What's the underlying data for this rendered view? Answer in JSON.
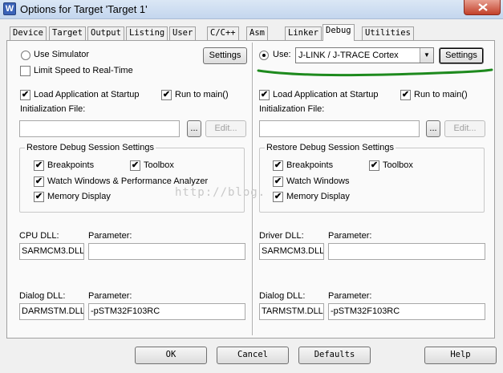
{
  "window": {
    "title": "Options for Target 'Target 1'",
    "icon": "W"
  },
  "tabs": [
    {
      "label": "Device"
    },
    {
      "label": "Target"
    },
    {
      "label": "Output"
    },
    {
      "label": "Listing"
    },
    {
      "label": "User"
    },
    {
      "label": "C/C++"
    },
    {
      "label": "Asm"
    },
    {
      "label": "Linker"
    },
    {
      "label": "Debug",
      "active": true
    },
    {
      "label": "Utilities"
    }
  ],
  "left": {
    "use_simulator_label": "Use Simulator",
    "use_simulator_selected": false,
    "limit_speed_label": "Limit Speed to Real-Time",
    "limit_speed_checked": false,
    "settings_label": "Settings",
    "load_app_label": "Load Application at Startup",
    "run_to_main_label": "Run to main()",
    "init_file_label": "Initialization File:",
    "browse_label": "...",
    "edit_label": "Edit...",
    "restore_group_title": "Restore Debug Session Settings",
    "breakpoints_label": "Breakpoints",
    "toolbox_label": "Toolbox",
    "watch_label": "Watch Windows & Performance Analyzer",
    "memory_label": "Memory Display",
    "cpu_dll_label": "CPU DLL:",
    "cpu_param_label": "Parameter:",
    "cpu_dll_value": "SARMCM3.DLL",
    "cpu_param_value": "",
    "dialog_dll_label": "Dialog DLL:",
    "dialog_param_label": "Parameter:",
    "dialog_dll_value": "DARMSTM.DLL",
    "dialog_param_value": "-pSTM32F103RC"
  },
  "right": {
    "use_label": "Use:",
    "use_selected": true,
    "driver_value": "J-LINK / J-TRACE Cortex",
    "settings_label": "Settings",
    "load_app_label": "Load Application at Startup",
    "run_to_main_label": "Run to main()",
    "init_file_label": "Initialization File:",
    "browse_label": "...",
    "edit_label": "Edit...",
    "restore_group_title": "Restore Debug Session Settings",
    "breakpoints_label": "Breakpoints",
    "toolbox_label": "Toolbox",
    "watch_label": "Watch Windows",
    "memory_label": "Memory Display",
    "driver_dll_label": "Driver DLL:",
    "driver_param_label": "Parameter:",
    "driver_dll_value": "SARMCM3.DLL",
    "driver_param_value": "",
    "dialog_dll_label": "Dialog DLL:",
    "dialog_param_label": "Parameter:",
    "dialog_dll_value": "TARMSTM.DLL",
    "dialog_param_value": "-pSTM32F103RC"
  },
  "watermark": "http://blog.",
  "check_mark": "✔",
  "buttons": {
    "ok": "OK",
    "cancel": "Cancel",
    "defaults": "Defaults",
    "help": "Help"
  },
  "colors": {
    "annotation_green": "#1e8a1e"
  }
}
